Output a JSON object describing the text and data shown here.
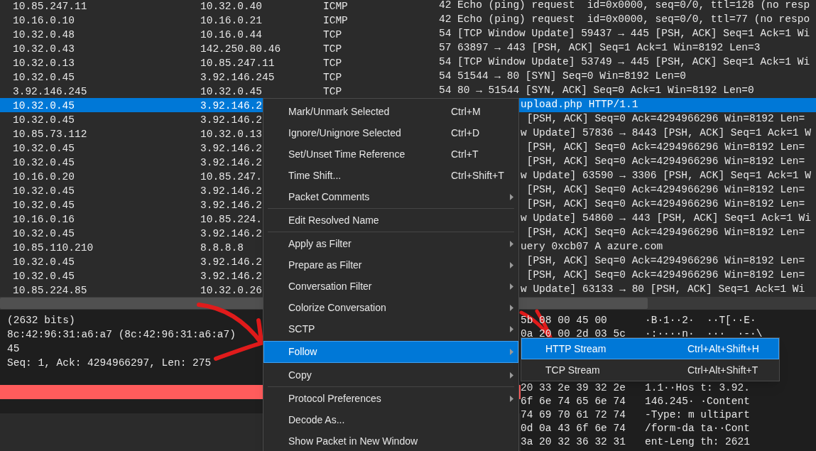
{
  "packet_list": {
    "rows": [
      {
        "kind": "full",
        "selected": false,
        "source": "10.85.247.11",
        "destination": "10.32.0.40",
        "protocol": "ICMP",
        "info": "42 Echo (ping) request  id=0x0000, seq=0/0, ttl=128 (no resp"
      },
      {
        "kind": "full",
        "selected": false,
        "source": "10.16.0.10",
        "destination": "10.16.0.21",
        "protocol": "ICMP",
        "info": "42 Echo (ping) request  id=0x0000, seq=0/0, ttl=77 (no respo"
      },
      {
        "kind": "full",
        "selected": false,
        "source": "10.32.0.48",
        "destination": "10.16.0.44",
        "protocol": "TCP",
        "info": "54 [TCP Window Update] 59437 → 445 [PSH, ACK] Seq=1 Ack=1 Wi"
      },
      {
        "kind": "full",
        "selected": false,
        "source": "10.32.0.43",
        "destination": "142.250.80.46",
        "protocol": "TCP",
        "info": "57 63897 → 443 [PSH, ACK] Seq=1 Ack=1 Win=8192 Len=3"
      },
      {
        "kind": "full",
        "selected": false,
        "source": "10.32.0.13",
        "destination": "10.85.247.11",
        "protocol": "TCP",
        "info": "54 [TCP Window Update] 53749 → 445 [PSH, ACK] Seq=1 Ack=1 Wi"
      },
      {
        "kind": "full",
        "selected": false,
        "source": "10.32.0.45",
        "destination": "3.92.146.245",
        "protocol": "TCP",
        "info": "54 51544 → 80 [SYN] Seq=0 Win=8192 Len=0"
      },
      {
        "kind": "full",
        "selected": false,
        "source": "3.92.146.245",
        "destination": "10.32.0.45",
        "protocol": "TCP",
        "info": "54 80 → 51544 [SYN, ACK] Seq=0 Ack=1 Win=8192 Len=0"
      },
      {
        "kind": "covered",
        "selected": true,
        "source": "10.32.0.45",
        "destination": "3.92.146.2",
        "info": "upload.php HTTP/1.1"
      },
      {
        "kind": "covered",
        "selected": false,
        "source": "10.32.0.45",
        "destination": "3.92.146.2",
        "info": " [PSH, ACK] Seq=0 Ack=4294966296 Win=8192 Len="
      },
      {
        "kind": "covered",
        "selected": false,
        "source": "10.85.73.112",
        "destination": "10.32.0.13",
        "info": "w Update] 57836 → 8443 [PSH, ACK] Seq=1 Ack=1 W"
      },
      {
        "kind": "covered",
        "selected": false,
        "source": "10.32.0.45",
        "destination": "3.92.146.2",
        "info": " [PSH, ACK] Seq=0 Ack=4294966296 Win=8192 Len="
      },
      {
        "kind": "covered",
        "selected": false,
        "source": "10.32.0.45",
        "destination": "3.92.146.2",
        "info": " [PSH, ACK] Seq=0 Ack=4294966296 Win=8192 Len="
      },
      {
        "kind": "covered",
        "selected": false,
        "source": "10.16.0.20",
        "destination": "10.85.247.",
        "info": "w Update] 63590 → 3306 [PSH, ACK] Seq=1 Ack=1 W"
      },
      {
        "kind": "covered",
        "selected": false,
        "source": "10.32.0.45",
        "destination": "3.92.146.2",
        "info": " [PSH, ACK] Seq=0 Ack=4294966296 Win=8192 Len="
      },
      {
        "kind": "covered",
        "selected": false,
        "source": "10.32.0.45",
        "destination": "3.92.146.2",
        "info": " [PSH, ACK] Seq=0 Ack=4294966296 Win=8192 Len="
      },
      {
        "kind": "covered",
        "selected": false,
        "source": "10.16.0.16",
        "destination": "10.85.224.",
        "info": "w Update] 54860 → 443 [PSH, ACK] Seq=1 Ack=1 Wi"
      },
      {
        "kind": "covered",
        "selected": false,
        "source": "10.32.0.45",
        "destination": "3.92.146.2",
        "info": " [PSH, ACK] Seq=0 Ack=4294966296 Win=8192 Len="
      },
      {
        "kind": "covered",
        "selected": false,
        "source": "10.85.110.210",
        "destination": "8.8.8.8",
        "info": "uery 0xcb07 A azure.com"
      },
      {
        "kind": "covered",
        "selected": false,
        "source": "10.32.0.45",
        "destination": "3.92.146.2",
        "info": " [PSH, ACK] Seq=0 Ack=4294966296 Win=8192 Len="
      },
      {
        "kind": "covered",
        "selected": false,
        "source": "10.32.0.45",
        "destination": "3.92.146.2",
        "info": " [PSH, ACK] Seq=0 Ack=4294966296 Win=8192 Len="
      },
      {
        "kind": "covered",
        "selected": false,
        "source": "10.85.224.85",
        "destination": "10.32.0.26",
        "info": "w Update] 63133 → 80 [PSH, ACK] Seq=1 Ack=1 Wi"
      }
    ]
  },
  "packet_details": {
    "lines": [
      "(2632 bits)",
      "8c:42:96:31:a6:a7 (8c:42:96:31:a6:a7)",
      "45",
      "Seq: 1, Ack: 4294966297, Len: 275"
    ]
  },
  "packet_bytes": {
    "rows_above": [
      {
        "hex": "5b 08 00 45 00",
        "ascii": "·B·1··2·  ··T[··E·"
      },
      {
        "hex": "0a 20 00 2d 03 5c",
        "ascii": "·:····n·  ···  ·-·\\"
      }
    ],
    "rows_below": [
      {
        "hex": "20 33 2e 39 32 2e",
        "ascii": "1.1··Hos t: 3.92."
      },
      {
        "hex": "6f 6e 74 65 6e 74",
        "ascii": "146.245· ·Content"
      },
      {
        "hex": "74 69 70 61 72 74",
        "ascii": "-Type: m ultipart"
      },
      {
        "hex": "0d 0a 43 6f 6e 74",
        "ascii": "/form-da ta··Cont"
      },
      {
        "hex": "3a 20 32 36 32 31",
        "ascii": "ent-Leng th: 2621"
      }
    ]
  },
  "context_menu": {
    "items": [
      {
        "kind": "item",
        "label": "Mark/Unmark Selected",
        "shortcut": "Ctrl+M",
        "submenu": false,
        "selected": false
      },
      {
        "kind": "item",
        "label": "Ignore/Unignore Selected",
        "shortcut": "Ctrl+D",
        "submenu": false,
        "selected": false
      },
      {
        "kind": "item",
        "label": "Set/Unset Time Reference",
        "shortcut": "Ctrl+T",
        "submenu": false,
        "selected": false
      },
      {
        "kind": "item",
        "label": "Time Shift...",
        "shortcut": "Ctrl+Shift+T",
        "submenu": false,
        "selected": false
      },
      {
        "kind": "item",
        "label": "Packet Comments",
        "submenu": true,
        "selected": false
      },
      {
        "kind": "separator"
      },
      {
        "kind": "item",
        "label": "Edit Resolved Name",
        "submenu": false,
        "selected": false
      },
      {
        "kind": "separator"
      },
      {
        "kind": "item",
        "label": "Apply as Filter",
        "submenu": true,
        "selected": false
      },
      {
        "kind": "item",
        "label": "Prepare as Filter",
        "submenu": true,
        "selected": false
      },
      {
        "kind": "item",
        "label": "Conversation Filter",
        "submenu": true,
        "selected": false
      },
      {
        "kind": "item",
        "label": "Colorize Conversation",
        "submenu": true,
        "selected": false
      },
      {
        "kind": "item",
        "label": "SCTP",
        "submenu": true,
        "selected": false
      },
      {
        "kind": "item",
        "label": "Follow",
        "submenu": true,
        "selected": true
      },
      {
        "kind": "item",
        "label": "Copy",
        "submenu": true,
        "selected": false
      },
      {
        "kind": "separator"
      },
      {
        "kind": "item",
        "label": "Protocol Preferences",
        "submenu": true,
        "selected": false
      },
      {
        "kind": "item",
        "label": "Decode As...",
        "submenu": false,
        "selected": false
      },
      {
        "kind": "item",
        "label": "Show Packet in New Window",
        "submenu": false,
        "selected": false
      }
    ]
  },
  "follow_submenu": {
    "items": [
      {
        "label": "HTTP Stream",
        "shortcut": "Ctrl+Alt+Shift+H",
        "selected": true
      },
      {
        "label": "TCP Stream",
        "shortcut": "Ctrl+Alt+Shift+T",
        "selected": false
      }
    ]
  }
}
